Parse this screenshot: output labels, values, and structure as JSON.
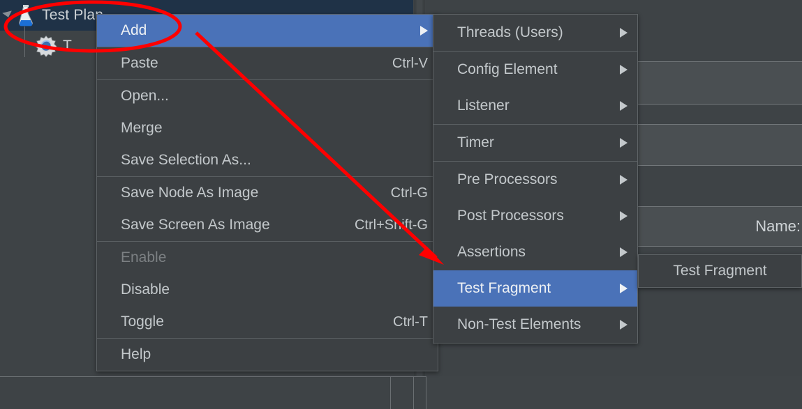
{
  "app": {
    "tree": {
      "root_label": "Test Plan",
      "root_icon": "flask-icon",
      "child_label": "T",
      "child_icon": "gear-icon"
    },
    "form": {
      "name_label": "Name:"
    }
  },
  "context_menu": {
    "items": [
      {
        "label": "Add",
        "accel": "",
        "arrow": true,
        "selected": true,
        "disabled": false
      },
      {
        "sep": true
      },
      {
        "label": "Paste",
        "accel": "Ctrl-V",
        "arrow": false,
        "selected": false,
        "disabled": false
      },
      {
        "sep": true
      },
      {
        "label": "Open...",
        "accel": "",
        "arrow": false,
        "selected": false,
        "disabled": false
      },
      {
        "label": "Merge",
        "accel": "",
        "arrow": false,
        "selected": false,
        "disabled": false
      },
      {
        "label": "Save Selection As...",
        "accel": "",
        "arrow": false,
        "selected": false,
        "disabled": false
      },
      {
        "sep": true
      },
      {
        "label": "Save Node As Image",
        "accel": "Ctrl-G",
        "arrow": false,
        "selected": false,
        "disabled": false
      },
      {
        "label": "Save Screen As Image",
        "accel": "Ctrl+Shift-G",
        "arrow": false,
        "selected": false,
        "disabled": false
      },
      {
        "sep": true
      },
      {
        "label": "Enable",
        "accel": "",
        "arrow": false,
        "selected": false,
        "disabled": true
      },
      {
        "label": "Disable",
        "accel": "",
        "arrow": false,
        "selected": false,
        "disabled": false
      },
      {
        "label": "Toggle",
        "accel": "Ctrl-T",
        "arrow": false,
        "selected": false,
        "disabled": false
      },
      {
        "sep": true
      },
      {
        "label": "Help",
        "accel": "",
        "arrow": false,
        "selected": false,
        "disabled": false
      }
    ]
  },
  "add_submenu": {
    "items": [
      {
        "label": "Threads (Users)",
        "arrow": true,
        "selected": false
      },
      {
        "sep": true
      },
      {
        "label": "Config Element",
        "arrow": true,
        "selected": false
      },
      {
        "label": "Listener",
        "arrow": true,
        "selected": false
      },
      {
        "sep": true
      },
      {
        "label": "Timer",
        "arrow": true,
        "selected": false
      },
      {
        "sep": true
      },
      {
        "label": "Pre Processors",
        "arrow": true,
        "selected": false
      },
      {
        "label": "Post Processors",
        "arrow": true,
        "selected": false
      },
      {
        "label": "Assertions",
        "arrow": true,
        "selected": false
      },
      {
        "label": "Test Fragment",
        "arrow": true,
        "selected": true
      },
      {
        "label": "Non-Test Elements",
        "arrow": true,
        "selected": false
      }
    ]
  },
  "fragment_submenu": {
    "items": [
      {
        "label": "Test Fragment",
        "arrow": false,
        "selected": false
      }
    ]
  },
  "annotations": {
    "ellipse_label": "highlight-ellipse",
    "arrow_label": "callout-arrow",
    "color": "#ff0000"
  },
  "colors": {
    "menu_bg": "#3c4043",
    "menu_selected": "#4a72b8",
    "panel_bg": "#3e4346",
    "tree_selected": "#1f3247",
    "text": "#c3c8cb"
  }
}
